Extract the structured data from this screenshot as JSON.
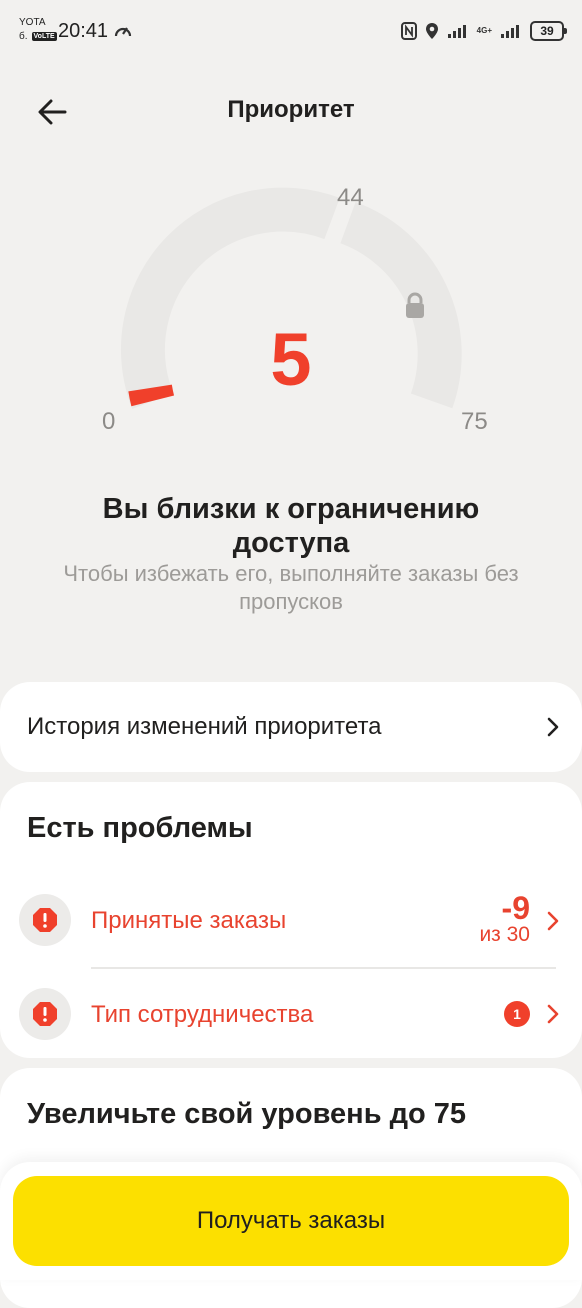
{
  "status_bar": {
    "carrier": "YOTA",
    "carrier_sub": "б.",
    "volte": "VoLTE",
    "time": "20:41",
    "network": "4G+",
    "battery": "39"
  },
  "header": {
    "title": "Приоритет",
    "back_icon": "arrow-left-icon"
  },
  "gauge": {
    "value": "5",
    "min_label": "0",
    "threshold_label": "44",
    "max_label": "75",
    "value_fraction": 0.067,
    "lock_icon": "lock-icon",
    "colors": {
      "track": "#e9e8e6",
      "indicator": "#f0402b",
      "value": "#f0402b"
    }
  },
  "status_message": {
    "title": "Вы близки к ограничению доступа",
    "subtitle": "Чтобы избежать его, выполняйте заказы без пропусков"
  },
  "history": {
    "label": "История изменений приоритета",
    "icon": "chevron-right-icon"
  },
  "problems": {
    "title": "Есть проблемы",
    "items": [
      {
        "label": "Принятые заказы",
        "value": "-9",
        "value_sub": "из 30",
        "icon": "alert-octagon-icon"
      },
      {
        "label": "Тип сотрудничества",
        "badge": "1",
        "icon": "alert-octagon-icon"
      }
    ]
  },
  "level": {
    "title": "Увеличьте свой уровень до 75"
  },
  "cta": {
    "label": "Получать заказы",
    "color": "#fce000"
  }
}
